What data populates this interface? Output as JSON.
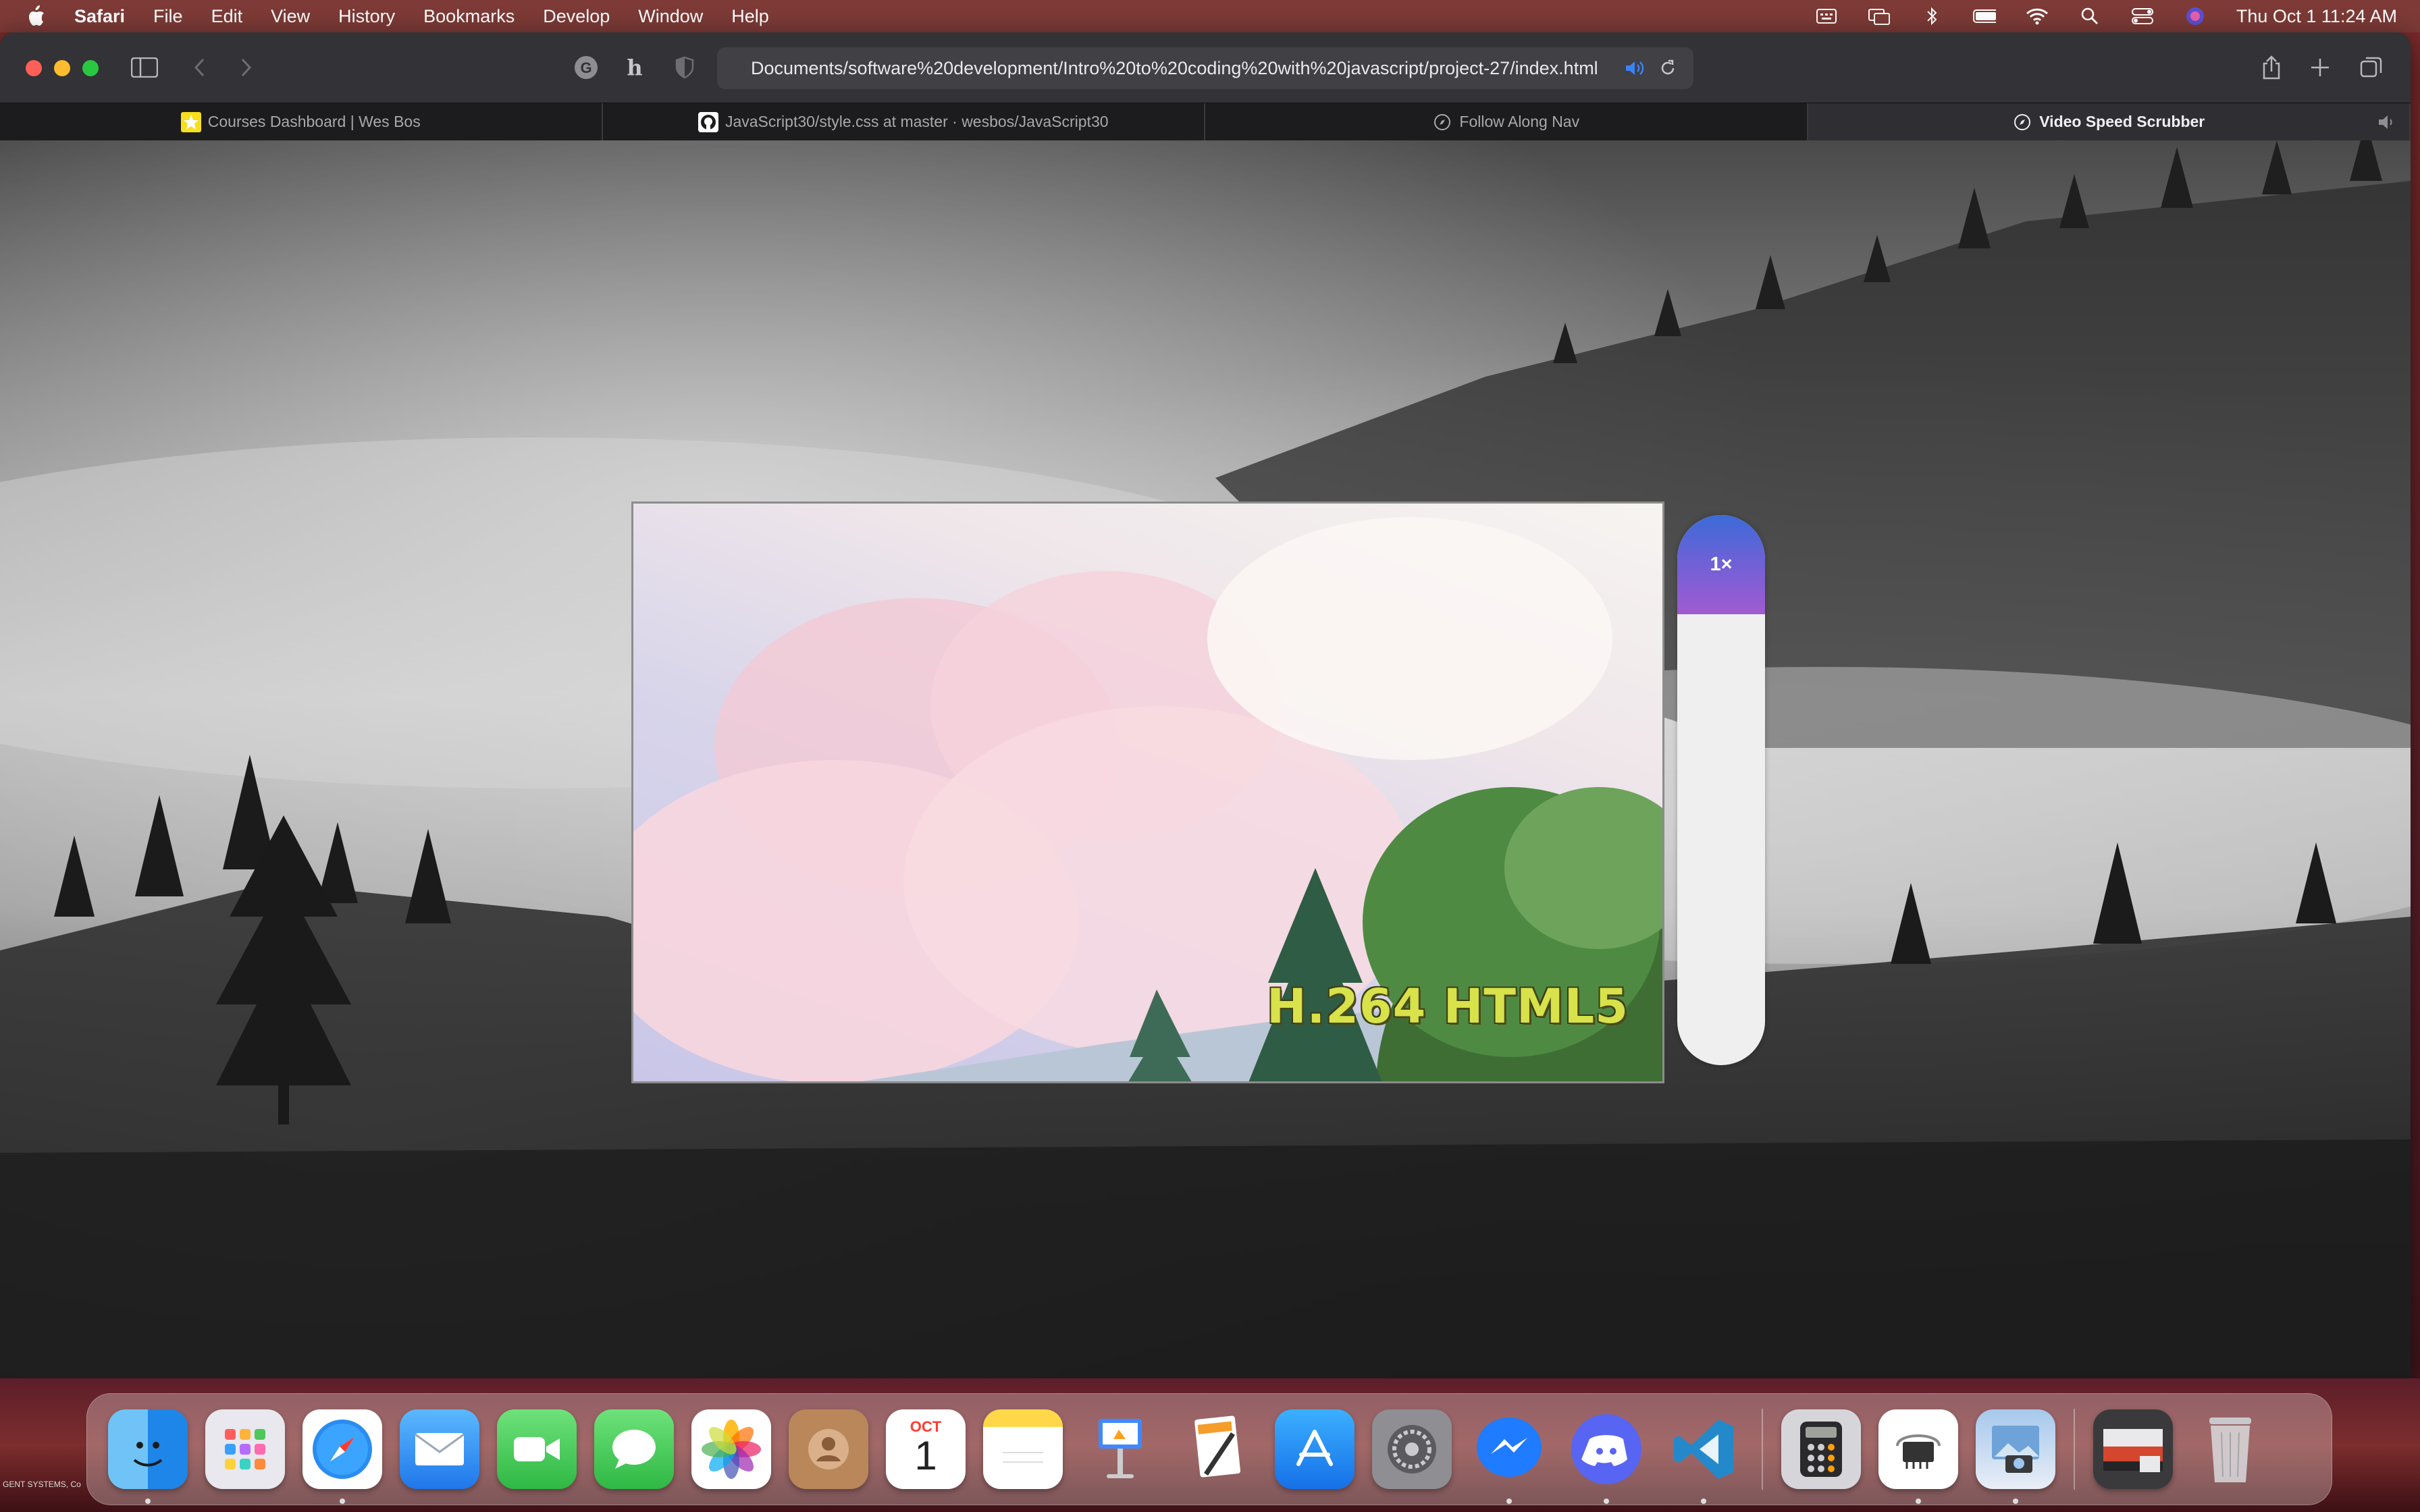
{
  "menubar": {
    "app_name": "Safari",
    "menus": [
      "File",
      "Edit",
      "View",
      "History",
      "Bookmarks",
      "Develop",
      "Window",
      "Help"
    ],
    "clock": "Thu Oct 1  11:24 AM"
  },
  "browser": {
    "address": "Documents/software%20development/Intro%20to%20coding%20with%20javascript/project-27/index.html",
    "tabs": [
      {
        "title": "Courses Dashboard | Wes Bos",
        "icon": "star-favicon",
        "active": false
      },
      {
        "title": "JavaScript30/style.css at master · wesbos/JavaScript30",
        "icon": "github-icon",
        "active": false
      },
      {
        "title": "Follow Along Nav",
        "icon": "compass-icon",
        "active": false
      },
      {
        "title": "Video Speed Scrubber",
        "icon": "compass-icon",
        "active": true
      }
    ]
  },
  "page": {
    "video_caption": "H.264 HTML5",
    "speed_label": "1×",
    "speed_fill_fraction": 0.18
  },
  "desktop": {
    "label": "GENT SYSTEMS, Co"
  },
  "dock": {
    "calendar_month": "OCT",
    "calendar_day": "1"
  },
  "colors": {
    "speed_gradient_top": "#3c6bd8",
    "speed_gradient_bottom": "#a15bd0",
    "caption": "#d8e24a"
  }
}
